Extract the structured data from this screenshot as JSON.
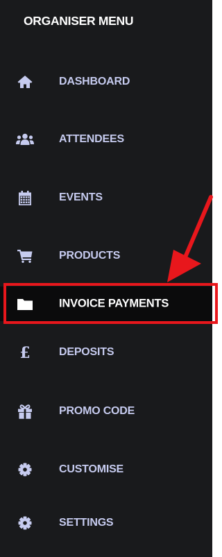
{
  "menu": {
    "title": "ORGANISER MENU",
    "items": [
      {
        "label": "DASHBOARD",
        "icon": "home-icon"
      },
      {
        "label": "ATTENDEES",
        "icon": "users-icon"
      },
      {
        "label": "EVENTS",
        "icon": "calendar-icon"
      },
      {
        "label": "PRODUCTS",
        "icon": "shopping-cart-icon"
      },
      {
        "label": "INVOICE PAYMENTS",
        "icon": "folder-icon",
        "active": true
      },
      {
        "label": "DEPOSITS",
        "icon": "pound-icon"
      },
      {
        "label": "PROMO CODE",
        "icon": "gift-icon"
      },
      {
        "label": "CUSTOMISE",
        "icon": "gear-icon"
      },
      {
        "label": "SETTINGS",
        "icon": "gear-icon"
      }
    ]
  },
  "colors": {
    "sidebar_bg": "#191a1c",
    "label": "#c6cbef",
    "active_label": "#ffffff",
    "annotation": "#e8171c"
  }
}
